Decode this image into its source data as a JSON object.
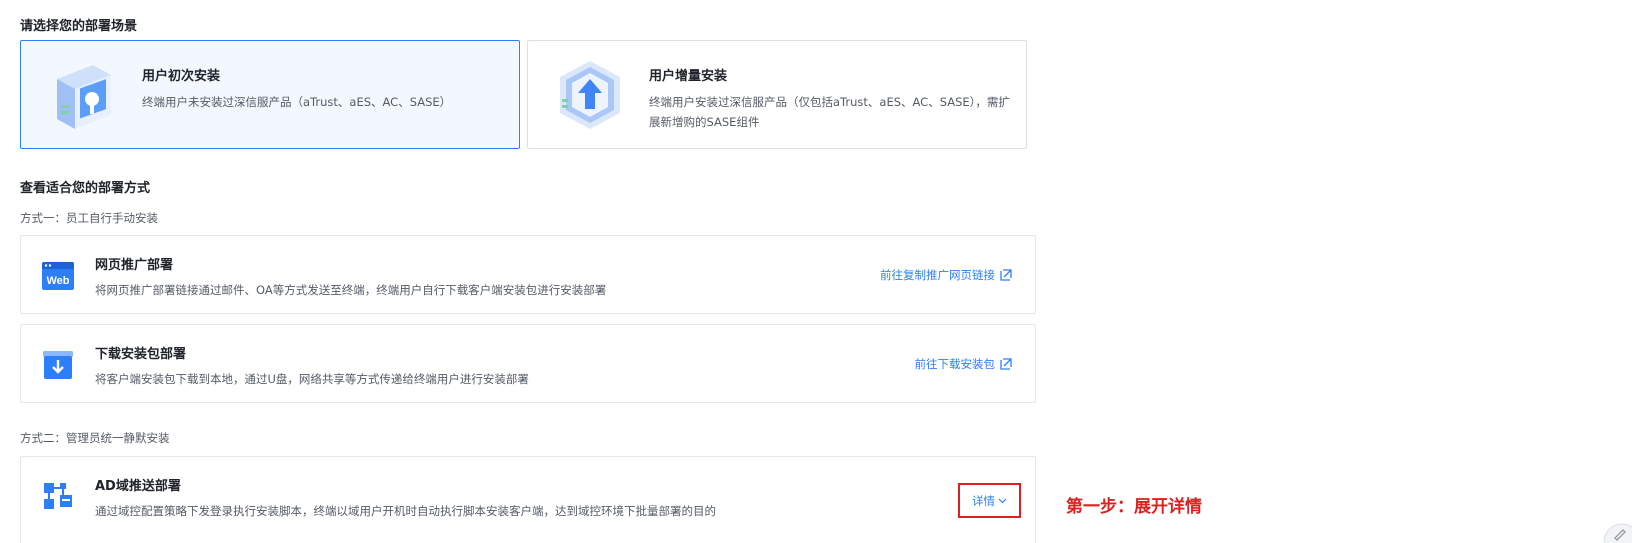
{
  "scene": {
    "title": "请选择您的部署场景",
    "cards": [
      {
        "name": "用户初次安装",
        "desc": "终端用户未安装过深信服产品（aTrust、aES、AC、SASE）",
        "selected": true
      },
      {
        "name": "用户增量安装",
        "desc": "终端用户安装过深信服产品（仅包括aTrust、aES、AC、SASE），需扩展新增购的SASE组件",
        "selected": false
      }
    ]
  },
  "methods": {
    "title": "查看适合您的部署方式",
    "mode1_label": "方式一：员工自行手动安装",
    "mode2_label": "方式二：管理员统一静默安装",
    "web": {
      "icon_text": "Web",
      "name": "网页推广部署",
      "desc": "将网页推广部署链接通过邮件、OA等方式发送至终端，终端用户自行下载客户端安装包进行安装部署",
      "link": "前往复制推广网页链接"
    },
    "download": {
      "name": "下载安装包部署",
      "desc": "将客户端安装包下载到本地，通过U盘，网络共享等方式传递给终端用户进行安装部署",
      "link": "前往下载安装包"
    },
    "ad": {
      "name": "AD域推送部署",
      "desc": "通过域控配置策略下发登录执行安装脚本，终端以域用户开机时自动执行脚本安装客户端，达到域控环境下批量部署的目的",
      "detail": "详情"
    }
  },
  "annotation": "第一步：展开详情",
  "colors": {
    "accent": "#2d7ff9",
    "highlight": "#e02020",
    "selected_bg": "#f3f8ff"
  }
}
